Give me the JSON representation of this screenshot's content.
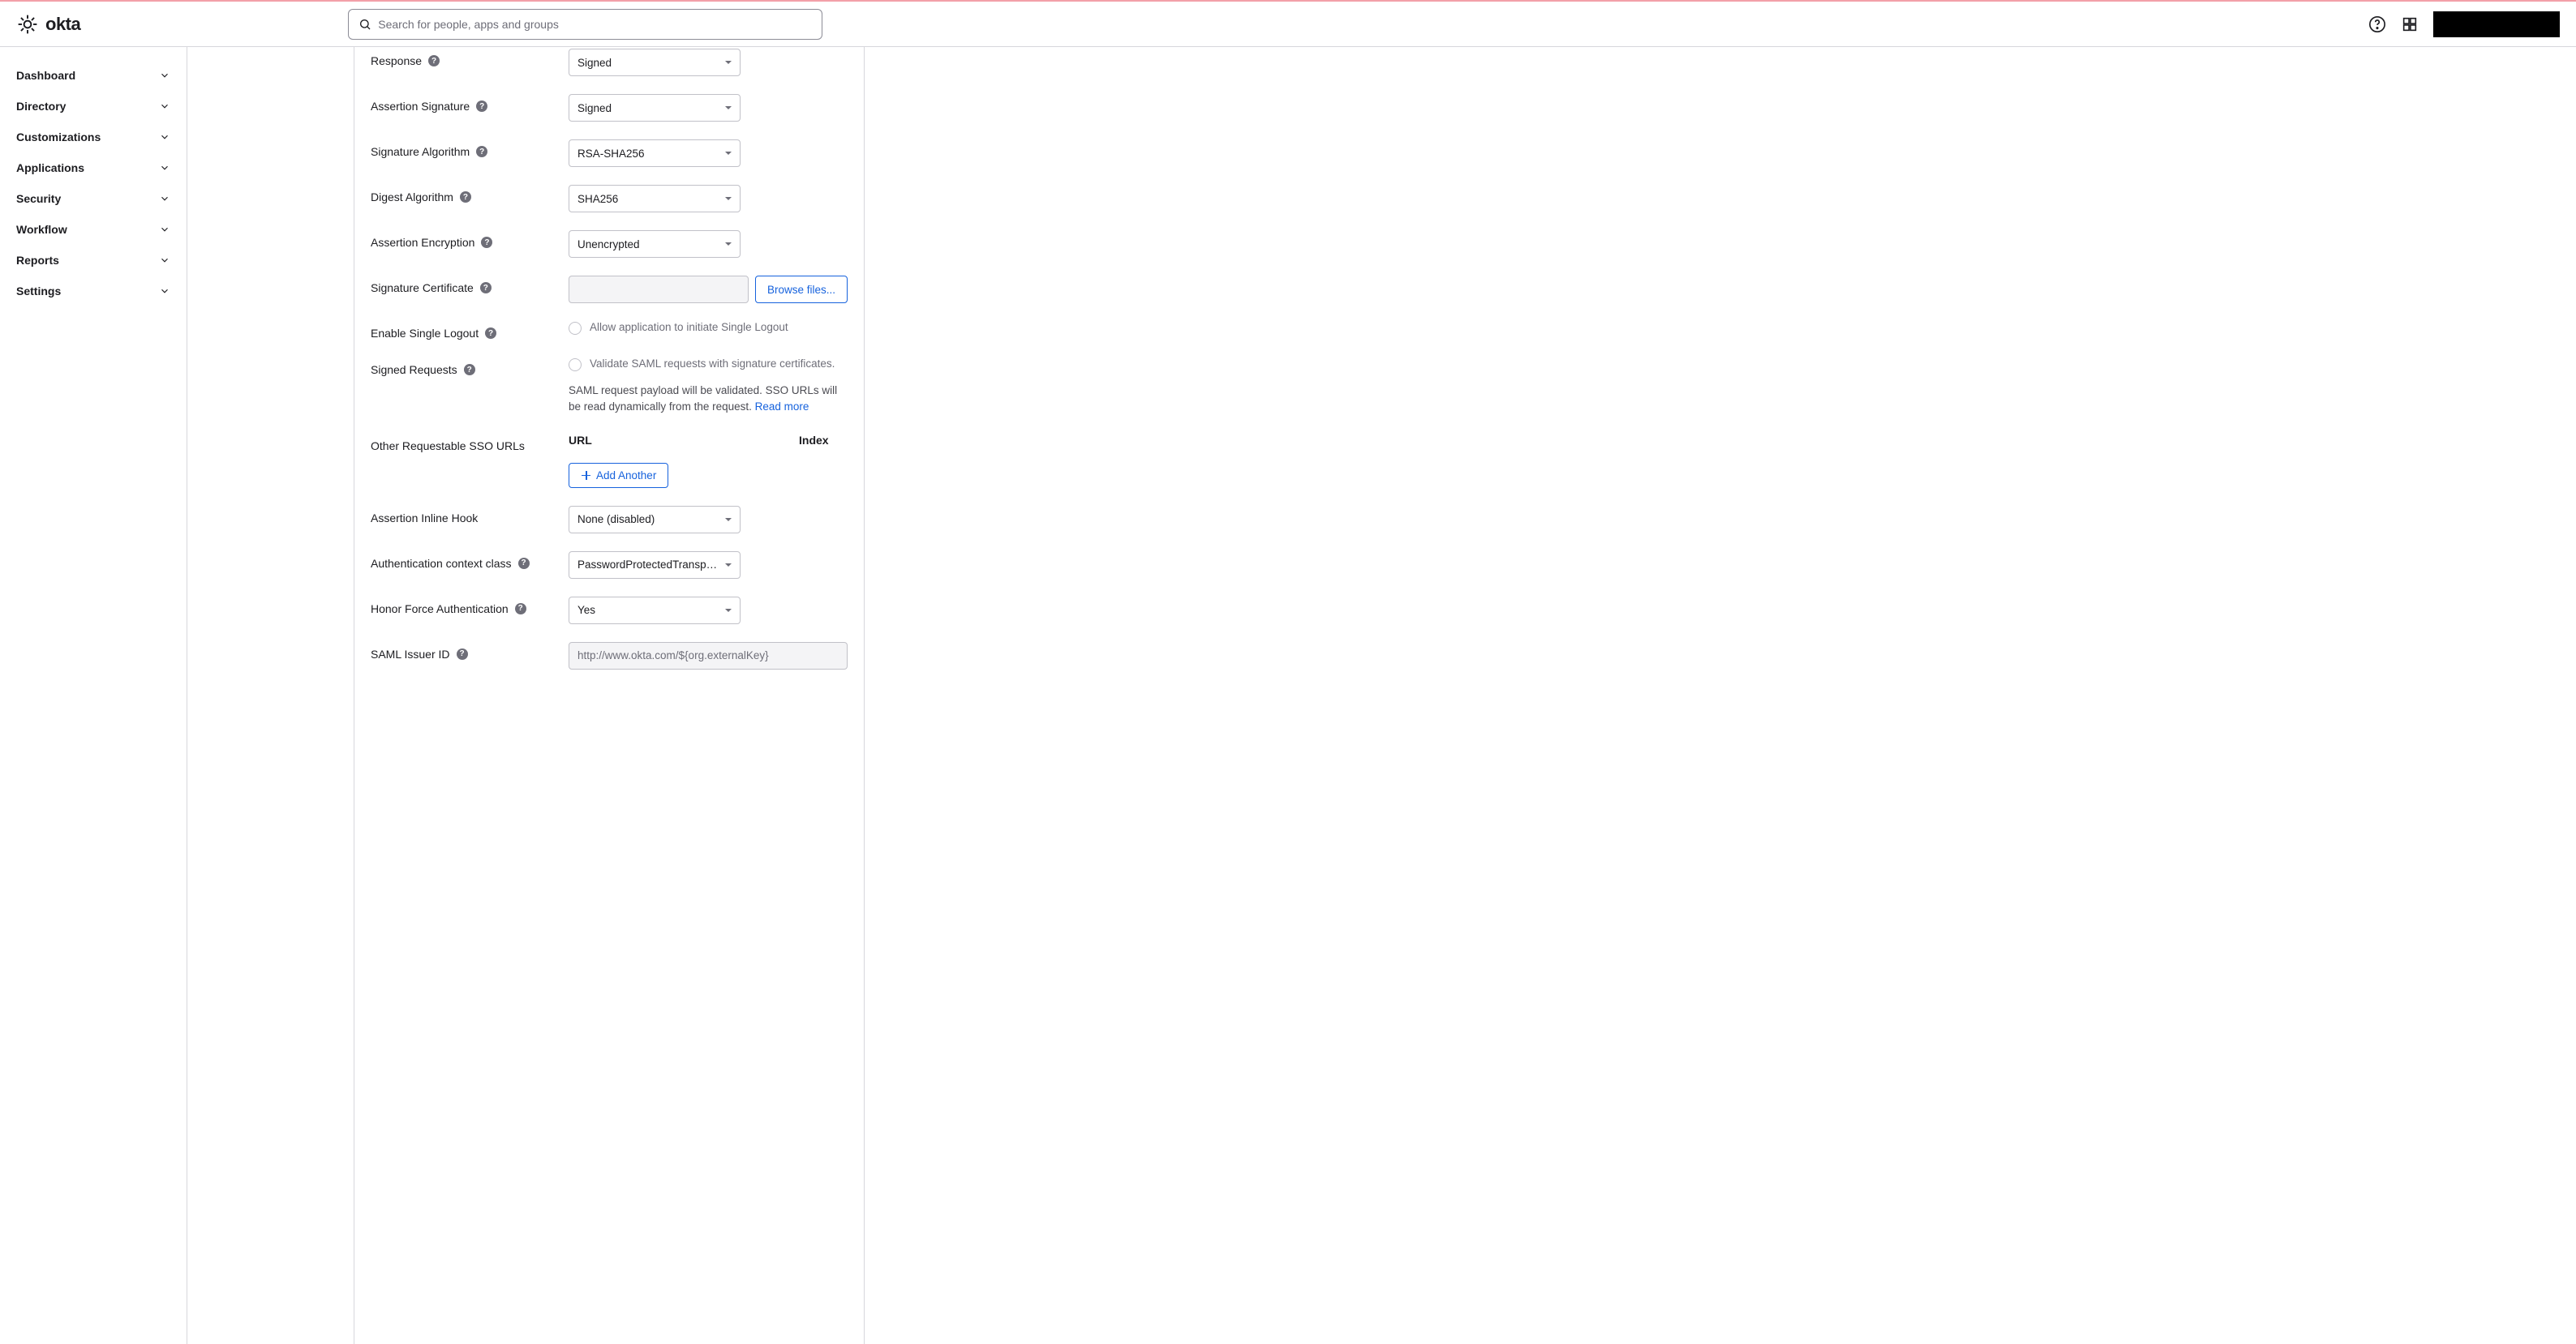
{
  "search": {
    "placeholder": "Search for people, apps and groups"
  },
  "sidebar": {
    "items": [
      {
        "label": "Dashboard"
      },
      {
        "label": "Directory"
      },
      {
        "label": "Customizations"
      },
      {
        "label": "Applications"
      },
      {
        "label": "Security"
      },
      {
        "label": "Workflow"
      },
      {
        "label": "Reports"
      },
      {
        "label": "Settings"
      }
    ]
  },
  "form": {
    "response": {
      "label": "Response",
      "value": "Signed"
    },
    "assertionSignature": {
      "label": "Assertion Signature",
      "value": "Signed"
    },
    "signatureAlgorithm": {
      "label": "Signature Algorithm",
      "value": "RSA-SHA256"
    },
    "digestAlgorithm": {
      "label": "Digest Algorithm",
      "value": "SHA256"
    },
    "assertionEncryption": {
      "label": "Assertion Encryption",
      "value": "Unencrypted"
    },
    "signatureCertificate": {
      "label": "Signature Certificate",
      "browse": "Browse files..."
    },
    "enableSingleLogout": {
      "label": "Enable Single Logout",
      "option": "Allow application to initiate Single Logout"
    },
    "signedRequests": {
      "label": "Signed Requests",
      "option": "Validate SAML requests with signature certificates.",
      "hint": "SAML request payload will be validated. SSO URLs will be read dynamically from the request. ",
      "readmore": "Read more"
    },
    "otherSsoUrls": {
      "label": "Other Requestable SSO URLs",
      "urlHeader": "URL",
      "indexHeader": "Index",
      "addAnother": "Add Another"
    },
    "assertionInlineHook": {
      "label": "Assertion Inline Hook",
      "value": "None (disabled)"
    },
    "authContextClass": {
      "label": "Authentication context class",
      "value": "PasswordProtectedTransp…"
    },
    "honorForceAuth": {
      "label": "Honor Force Authentication",
      "value": "Yes"
    },
    "samlIssuerId": {
      "label": "SAML Issuer ID",
      "value": "http://www.okta.com/${org.externalKey}"
    }
  }
}
